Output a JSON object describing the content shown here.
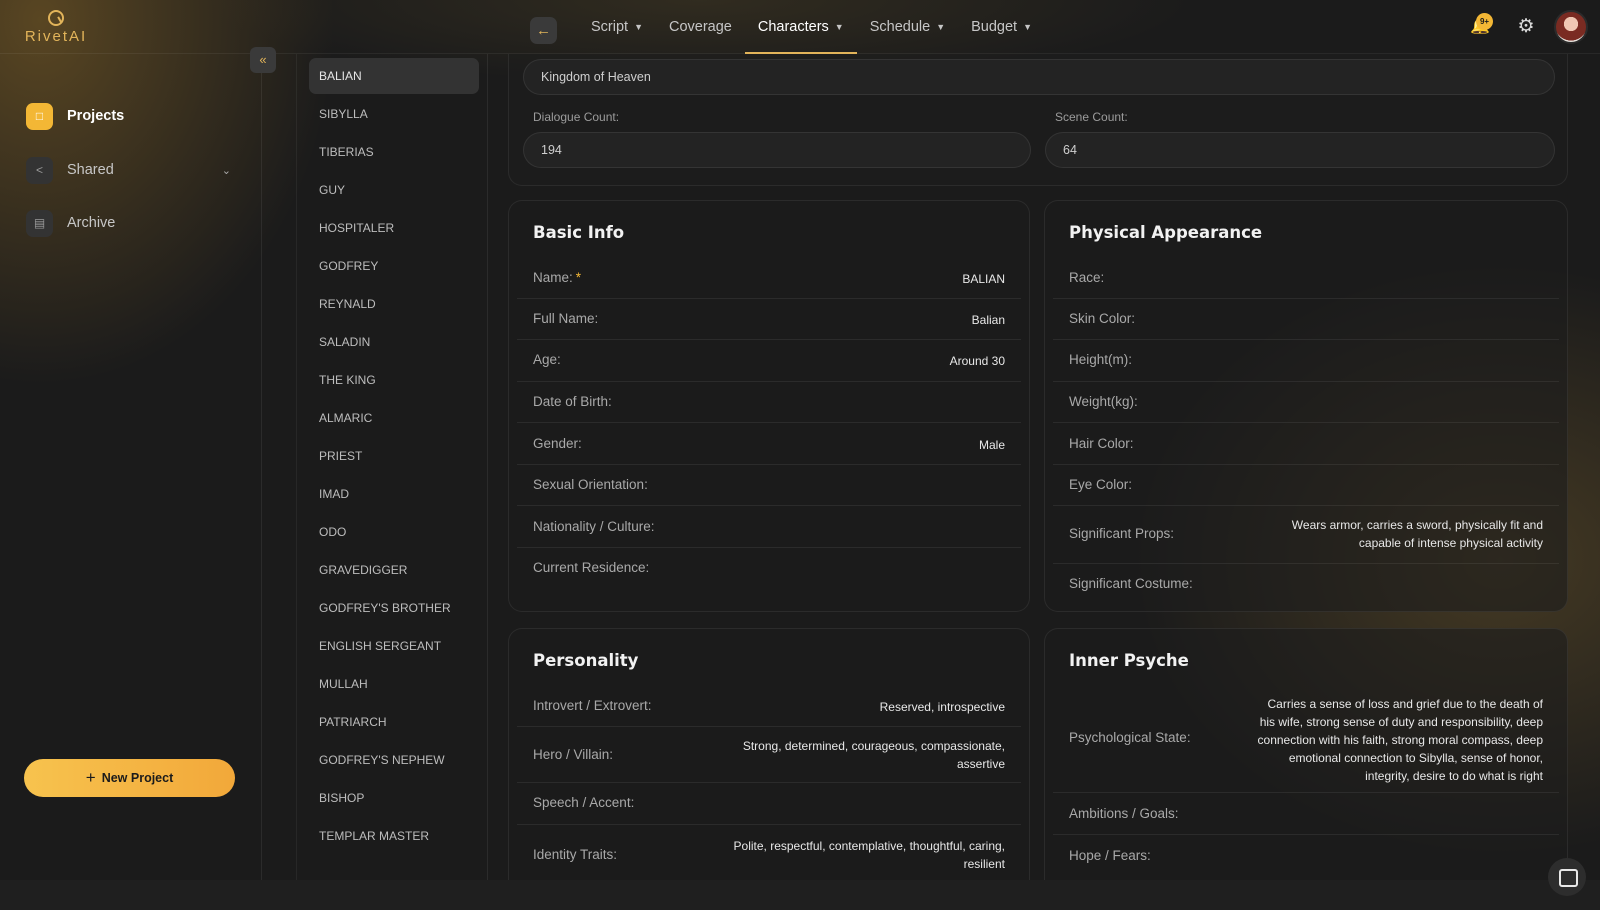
{
  "app": {
    "logo_text": "RivetAI"
  },
  "nav": {
    "back_icon": "arrow-left-icon",
    "items": [
      {
        "label": "Script",
        "has_dropdown": true,
        "active": false
      },
      {
        "label": "Coverage",
        "has_dropdown": false,
        "active": false
      },
      {
        "label": "Characters",
        "has_dropdown": true,
        "active": true
      },
      {
        "label": "Schedule",
        "has_dropdown": true,
        "active": false
      },
      {
        "label": "Budget",
        "has_dropdown": true,
        "active": false
      }
    ],
    "notification_badge": "9+"
  },
  "sidebar": {
    "items": [
      {
        "label": "Projects",
        "icon": "folder-icon"
      },
      {
        "label": "Shared",
        "icon": "share-icon"
      },
      {
        "label": "Archive",
        "icon": "archive-icon"
      }
    ],
    "new_project_label": "New Project"
  },
  "characters": [
    "BALIAN",
    "SIBYLLA",
    "TIBERIAS",
    "GUY",
    "HOSPITALER",
    "GODFREY",
    "REYNALD",
    "SALADIN",
    "THE KING",
    "ALMARIC",
    "PRIEST",
    "IMAD",
    "ODO",
    "GRAVEDIGGER",
    "GODFREY'S BROTHER",
    "ENGLISH SERGEANT",
    "MULLAH",
    "PATRIARCH",
    "GODFREY'S NEPHEW",
    "BISHOP",
    "TEMPLAR MASTER"
  ],
  "selected_character": "BALIAN",
  "summary": {
    "project_name": "Kingdom of Heaven",
    "dialogue_count_label": "Dialogue Count:",
    "dialogue_count": "194",
    "scene_count_label": "Scene Count:",
    "scene_count": "64"
  },
  "basic_info": {
    "title": "Basic Info",
    "rows": [
      {
        "label": "Name:",
        "value": "BALIAN",
        "required": true
      },
      {
        "label": "Full Name:",
        "value": "Balian"
      },
      {
        "label": "Age:",
        "value": "Around 30"
      },
      {
        "label": "Date of Birth:",
        "value": ""
      },
      {
        "label": "Gender:",
        "value": "Male"
      },
      {
        "label": "Sexual Orientation:",
        "value": ""
      },
      {
        "label": "Nationality / Culture:",
        "value": ""
      },
      {
        "label": "Current Residence:",
        "value": ""
      }
    ]
  },
  "physical": {
    "title": "Physical Appearance",
    "rows": [
      {
        "label": "Race:",
        "value": ""
      },
      {
        "label": "Skin Color:",
        "value": ""
      },
      {
        "label": "Height(m):",
        "value": ""
      },
      {
        "label": "Weight(kg):",
        "value": ""
      },
      {
        "label": "Hair Color:",
        "value": ""
      },
      {
        "label": "Eye Color:",
        "value": ""
      },
      {
        "label": "Significant Props:",
        "value": "Wears armor, carries a sword, physically fit and capable of intense physical activity"
      },
      {
        "label": "Significant Costume:",
        "value": ""
      }
    ]
  },
  "personality": {
    "title": "Personality",
    "rows": [
      {
        "label": "Introvert / Extrovert:",
        "value": "Reserved, introspective"
      },
      {
        "label": "Hero / Villain:",
        "value": "Strong, determined, courageous, compassionate, assertive"
      },
      {
        "label": "Speech / Accent:",
        "value": ""
      },
      {
        "label": "Identity Traits:",
        "value": "Polite, respectful, contemplative, thoughtful, caring, resilient"
      }
    ]
  },
  "psyche": {
    "title": "Inner Psyche",
    "rows": [
      {
        "label": "Psychological State:",
        "value": "Carries a sense of loss and grief due to the death of his wife, strong sense of duty and responsibility, deep connection with his faith, strong moral compass, deep emotional connection to Sibylla, sense of honor, integrity, desire to do what is right"
      },
      {
        "label": "Ambitions / Goals:",
        "value": ""
      },
      {
        "label": "Hope / Fears:",
        "value": ""
      }
    ]
  }
}
